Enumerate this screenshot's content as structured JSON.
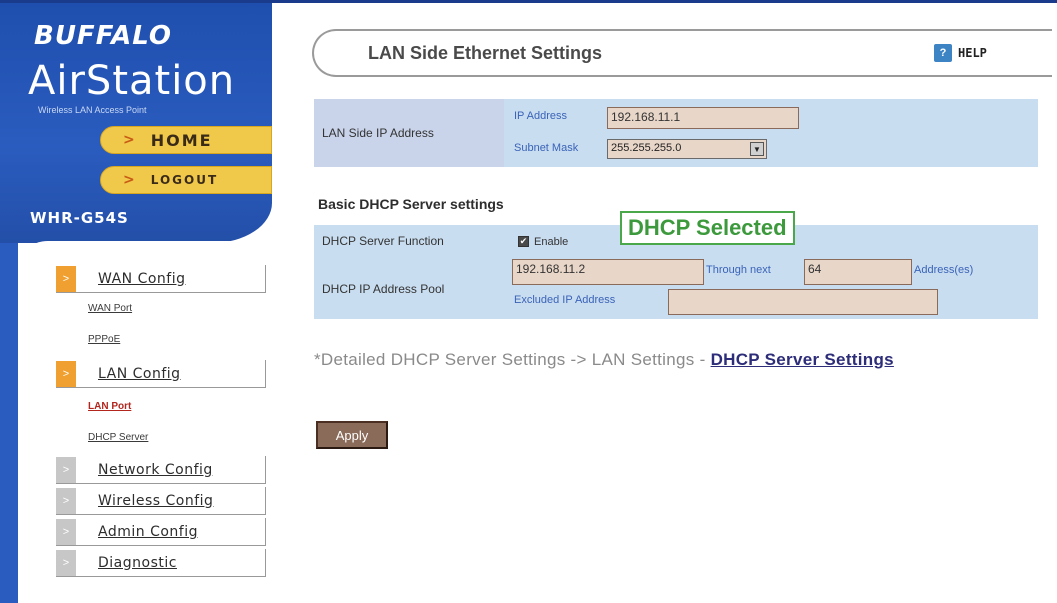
{
  "sidebar": {
    "brand": "BUFFALO",
    "product": "AirStation",
    "tagline": "Wireless LAN Access Point",
    "home_label": "HOME",
    "logout_label": "LOGOUT",
    "model": "WHR-G54S",
    "menu": [
      {
        "label": "WAN Config"
      },
      {
        "label": "LAN Config"
      },
      {
        "label": "Network Config"
      },
      {
        "label": "Wireless Config"
      },
      {
        "label": "Admin Config"
      },
      {
        "label": "Diagnostic"
      }
    ],
    "wan_sub": [
      "WAN Port",
      "PPPoE"
    ],
    "lan_sub": [
      "LAN Port",
      "DHCP Server"
    ]
  },
  "header": {
    "title": "LAN Side Ethernet Settings",
    "help_label": "HELP"
  },
  "lan_ip": {
    "section_label": "LAN Side IP Address",
    "ip_label": "IP Address",
    "ip_value": "192.168.11.1",
    "mask_label": "Subnet Mask",
    "mask_value": "255.255.255.0"
  },
  "dhcp": {
    "heading": "Basic DHCP Server settings",
    "function_label": "DHCP Server Function",
    "enable_label": "Enable",
    "pool_label": "DHCP IP Address Pool",
    "pool_start": "192.168.11.2",
    "through_label": "Through next",
    "pool_count": "64",
    "address_label": "Address(es)",
    "excluded_label": "Excluded IP Address",
    "excluded_value": ""
  },
  "callout": "DHCP Selected",
  "note": {
    "text": "*Detailed DHCP Server Settings -> LAN Settings - ",
    "link": "DHCP Server Settings"
  },
  "apply_label": "Apply"
}
